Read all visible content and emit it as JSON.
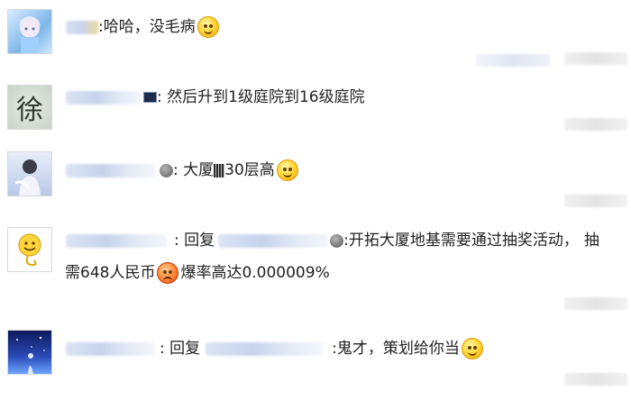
{
  "comments": [
    {
      "avatar_icon": "anime-character-avatar",
      "segments": [
        ": ",
        "哈哈，没毛病"
      ],
      "emoji": "smirk-emoji"
    },
    {
      "avatar_icon": "calligraphy-avatar",
      "avatar_char": "徐",
      "text": ": 然后升到1级庭院到16级庭院"
    },
    {
      "avatar_icon": "person-photo-avatar",
      "text_a": ": 大厦",
      "text_b": "30层高"
    },
    {
      "avatar_icon": "emoji-avatar",
      "reply_label": ": 回复",
      "text_line1": ":开拓大厦地基需要通过抽奖活动，",
      "text_line1_tail": "抽",
      "text_line2_a": "需648人民币",
      "text_line2_b": "爆率高达0.000009%"
    },
    {
      "avatar_icon": "night-sky-avatar",
      "reply_label": ": 回复",
      "text": ":鬼才，策划给你当"
    }
  ]
}
